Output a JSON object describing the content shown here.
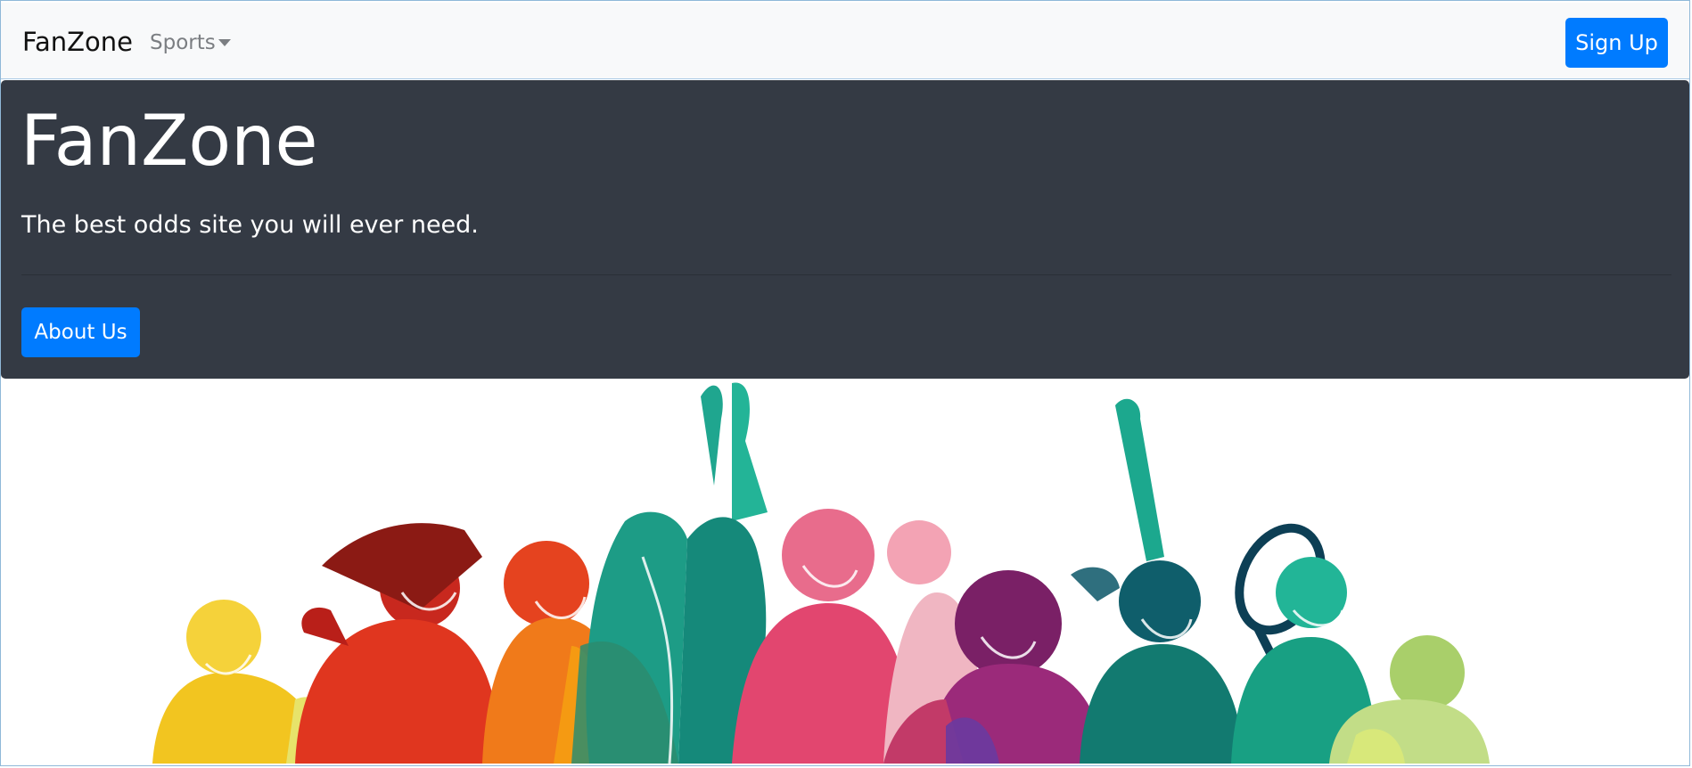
{
  "navbar": {
    "brand": "FanZone",
    "sports_label": "Sports",
    "signup_label": "Sign Up"
  },
  "jumbotron": {
    "title": "FanZone",
    "subtitle": "The best odds site you will ever need.",
    "about_label": "About Us"
  },
  "colors": {
    "primary": "#007bff",
    "dark": "#343a44",
    "navbar_bg": "#f8f9fa"
  },
  "hero_image": {
    "icon": "sports-silhouettes-illustration"
  }
}
